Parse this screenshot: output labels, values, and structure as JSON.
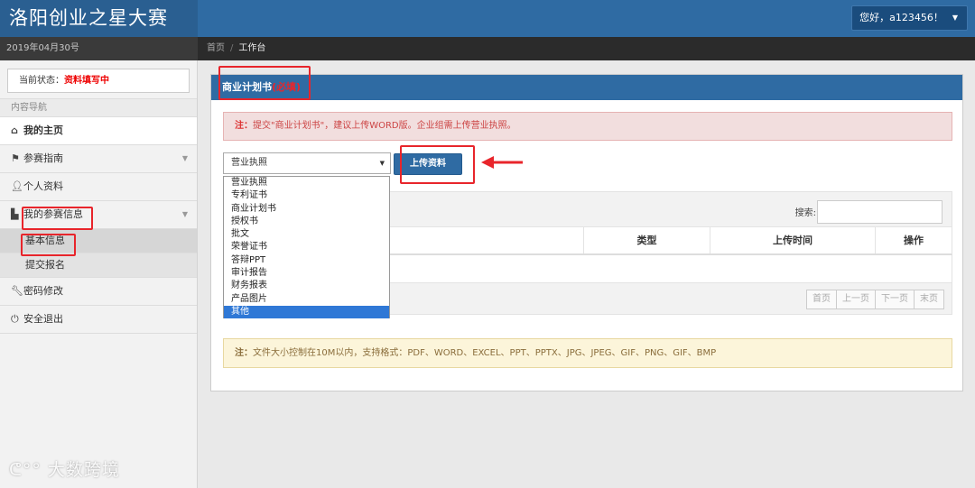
{
  "app": {
    "title": "洛阳创业之星大赛"
  },
  "user": {
    "greeting": "您好，a123456！"
  },
  "date": "2019年04月30号",
  "breadcrumb": {
    "home": "首页",
    "separator": "/",
    "current": "工作台"
  },
  "sidebar": {
    "status_label": "当前状态：",
    "status_value": "资料填写中",
    "nav_heading": "内容导航",
    "items": [
      {
        "label": "我的主页",
        "icon": "home-icon"
      },
      {
        "label": "参赛指南",
        "icon": "flag-icon"
      },
      {
        "label": "个人资料",
        "icon": "user-icon"
      },
      {
        "label": "我的参赛信息",
        "icon": "document-icon"
      },
      {
        "label": "基本信息"
      },
      {
        "label": "提交报名"
      },
      {
        "label": "密码修改",
        "icon": "wrench-icon"
      },
      {
        "label": "安全退出",
        "icon": "power-icon"
      }
    ],
    "watermark": "大数跨境"
  },
  "panel": {
    "title": "商业计划书",
    "title_tag": "(必填)",
    "alert_prefix": "注：",
    "alert_text": "提交\"商业计划书\"，建议上传WORD版。企业组需上传营业执照。",
    "select_value": "营业执照",
    "upload_label": "上传资料",
    "dropdown_options": [
      "营业执照",
      "专利证书",
      "商业计划书",
      "授权书",
      "批文",
      "荣誉证书",
      "答辩PPT",
      "审计报告",
      "财务报表",
      "产品图片",
      "其他"
    ],
    "search_label": "搜索:",
    "columns": [
      "",
      "类型",
      "上传时间",
      "操作"
    ],
    "pager": [
      "首页",
      "上一页",
      "下一页",
      "末页"
    ],
    "footer_prefix": "注：",
    "footer_text": "文件大小控制在10M以内，支持格式：PDF、WORD、EXCEL、PPT、PPTX、JPG、JPEG、GIF、PNG、GIF、BMP"
  },
  "colors": {
    "primary": "#2f6ba3",
    "annotation_red": "#e8252b",
    "status_red": "#ee0000"
  }
}
